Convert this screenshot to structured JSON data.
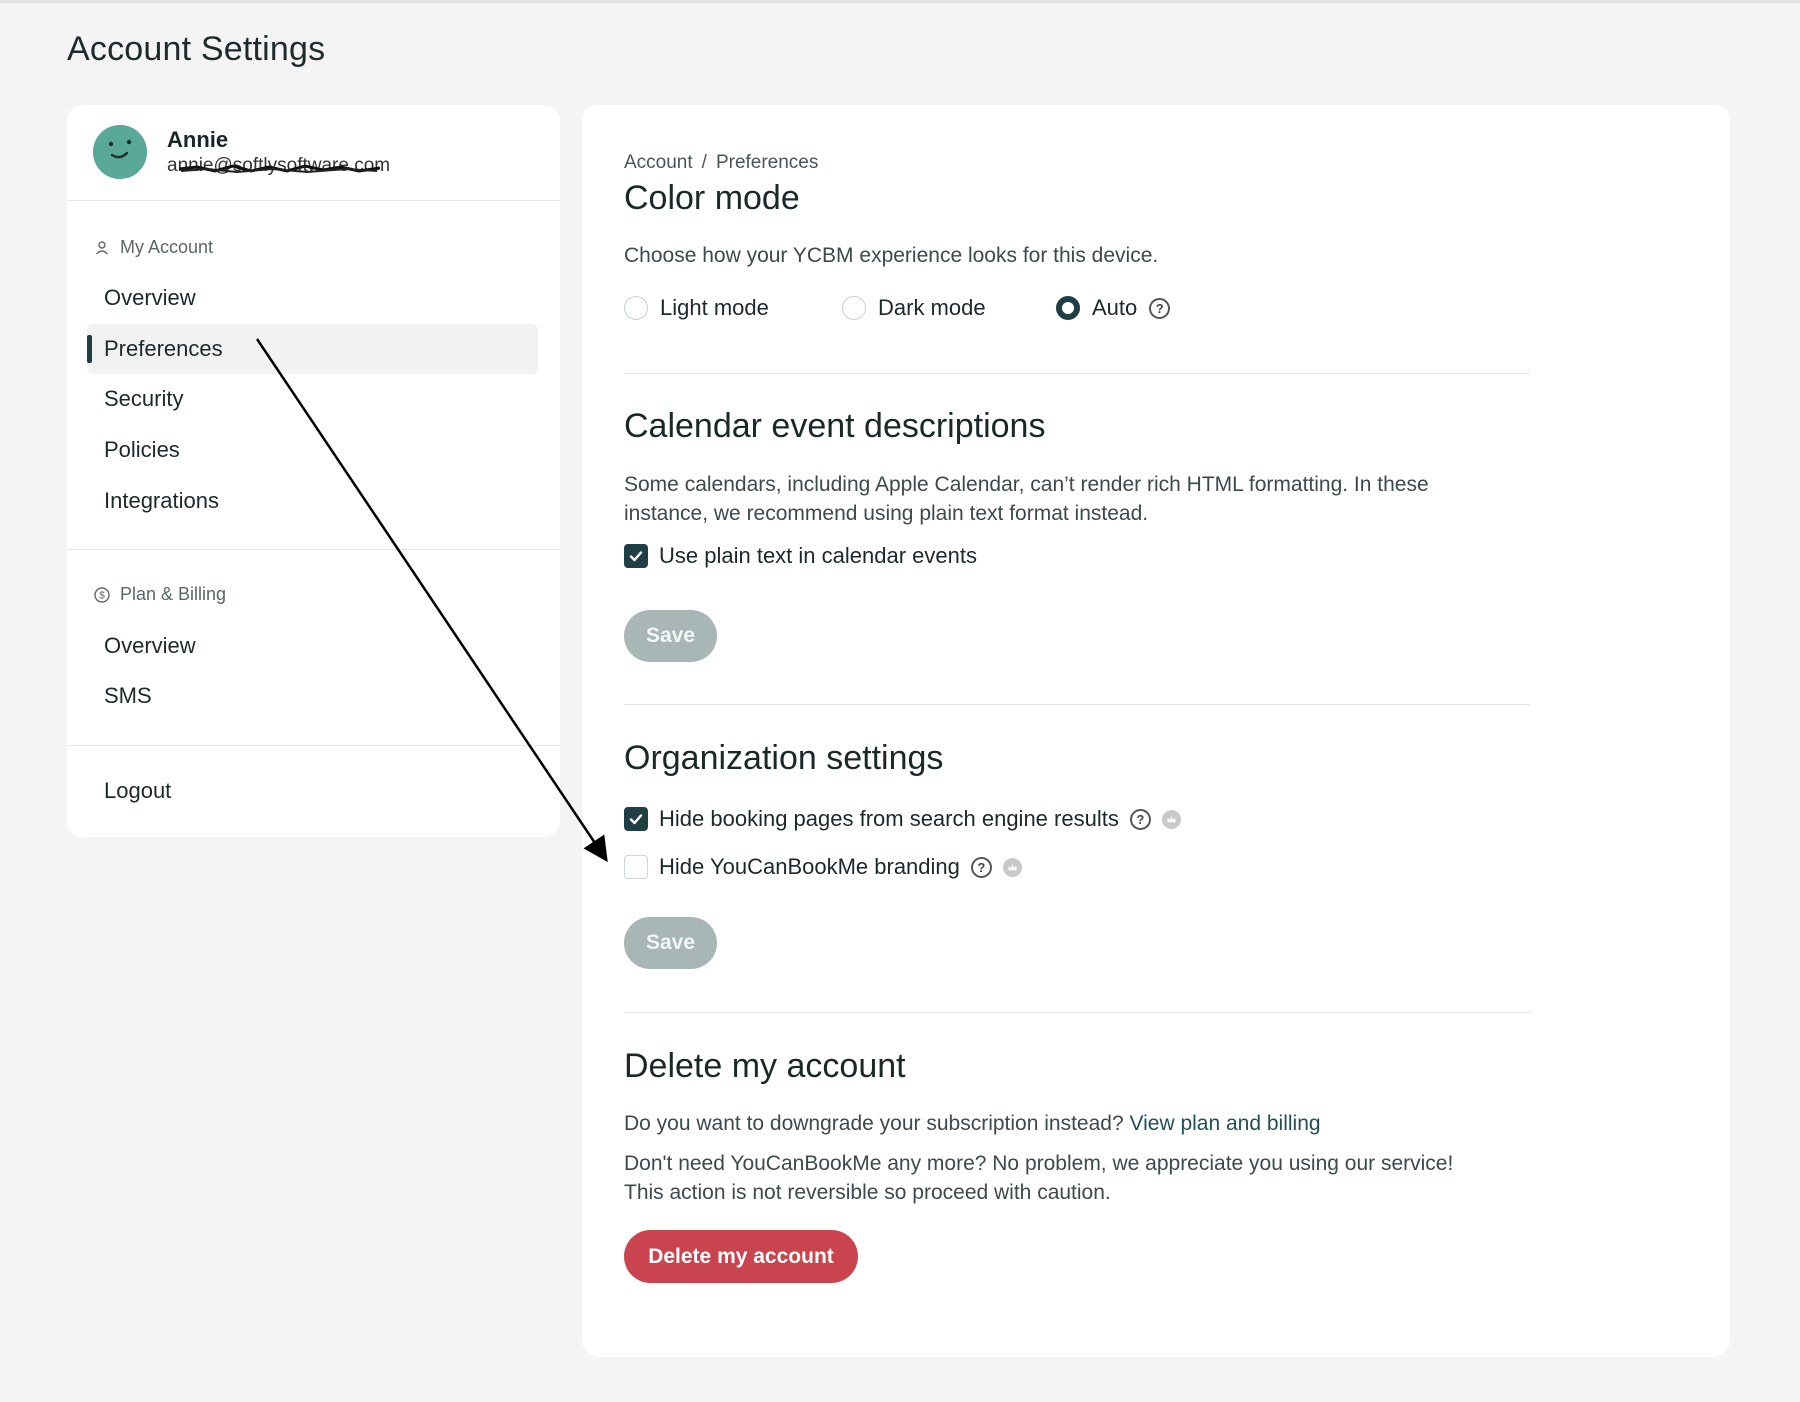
{
  "page": {
    "title": "Account Settings"
  },
  "profile": {
    "name": "Annie",
    "email": "annie@softlysoftware.com"
  },
  "sidebar": {
    "my_account": {
      "heading": "My Account",
      "items": [
        {
          "label": "Overview"
        },
        {
          "label": "Preferences",
          "active": true
        },
        {
          "label": "Security"
        },
        {
          "label": "Policies"
        },
        {
          "label": "Integrations"
        }
      ]
    },
    "billing": {
      "heading": "Plan & Billing",
      "items": [
        {
          "label": "Overview"
        },
        {
          "label": "SMS"
        }
      ]
    },
    "logout_label": "Logout"
  },
  "breadcrumb": {
    "root": "Account",
    "separator": "/",
    "current": "Preferences"
  },
  "color_mode": {
    "title": "Color mode",
    "description": "Choose how your YCBM experience looks for this device.",
    "options": [
      {
        "label": "Light mode",
        "selected": false
      },
      {
        "label": "Dark mode",
        "selected": false
      },
      {
        "label": "Auto",
        "selected": true
      }
    ]
  },
  "calendar": {
    "title": "Calendar event descriptions",
    "description_line1": "Some calendars, including Apple Calendar, can’t render rich HTML formatting. In these",
    "description_line2": "instance, we recommend using plain text format instead.",
    "checkbox_label": "Use plain text in calendar events",
    "checked": true,
    "save_label": "Save"
  },
  "organization": {
    "title": "Organization settings",
    "options": [
      {
        "label": "Hide booking pages from search engine results",
        "checked": true
      },
      {
        "label": "Hide YouCanBookMe branding",
        "checked": false
      }
    ],
    "save_label": "Save"
  },
  "delete": {
    "title": "Delete my account",
    "downgrade_text": "Do you want to downgrade your subscription instead?",
    "downgrade_link": "View plan and billing",
    "warning_line1": "Don't need YouCanBookMe any more? No problem, we appreciate you using our service!",
    "warning_line2": "This action is not reversible so proceed with caution.",
    "button_label": "Delete my account"
  },
  "colors": {
    "accent": "#1f3f44",
    "danger": "#c9444e",
    "disabled_button": "#a8b6b6",
    "avatar": "#5aa898",
    "page_bg": "#f4f4f4"
  }
}
